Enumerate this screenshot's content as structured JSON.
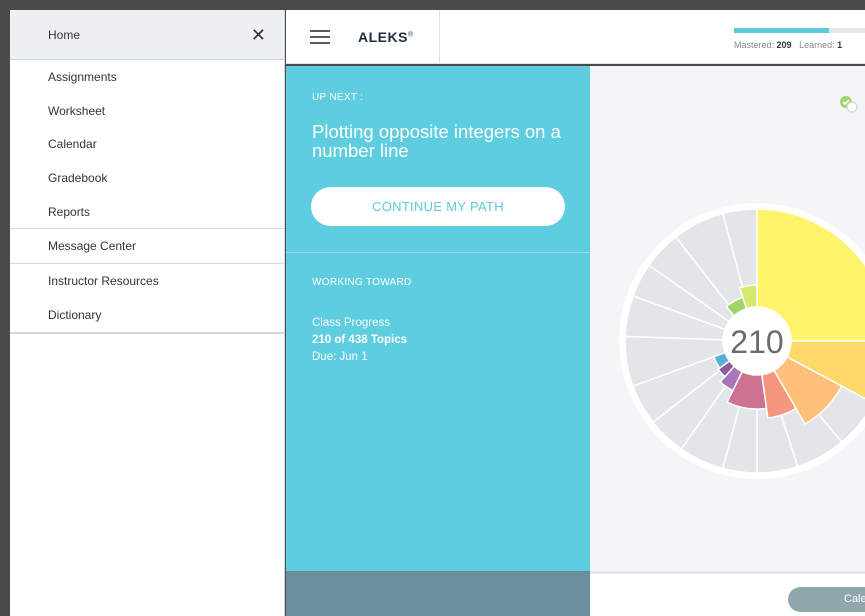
{
  "sidebar": {
    "header_label": "Home",
    "close_glyph": "✕",
    "group1": [
      "Assignments",
      "Worksheet",
      "Calendar",
      "Gradebook",
      "Reports"
    ],
    "group2": [
      "Message Center"
    ],
    "group3": [
      "Instructor Resources",
      "Dictionary"
    ]
  },
  "topbar": {
    "logo": "ALEKS",
    "logo_mark": "®",
    "progress_fraction": 0.68,
    "mastered_label": "Mastered:",
    "mastered_value": "209",
    "learned_label": "Learned:",
    "learned_value": "1"
  },
  "panel": {
    "up_next": "UP NEXT :",
    "topic": "Plotting opposite integers on a number line",
    "continue_button": "CONTINUE MY PATH",
    "working_toward": "WORKING TOWARD",
    "class_progress": "Class Progress",
    "topics": "210 of 438 Topics",
    "due": "Due: Jun 1"
  },
  "pie": {
    "center_value": "210"
  },
  "bottom": {
    "calendar_button": "Calendar"
  },
  "colors": {
    "accent": "#5ecde0",
    "footer": "#6a8f9c",
    "yellow": "#fff36b",
    "light_orange": "#ffd86a",
    "orange": "#ffc07a",
    "salmon": "#f7967f",
    "rose": "#cd7291",
    "purple": "#a777b9",
    "blue": "#5aaedb",
    "green": "#9fd56b",
    "lime": "#d7e86a",
    "gray": "#e3e6e8"
  }
}
